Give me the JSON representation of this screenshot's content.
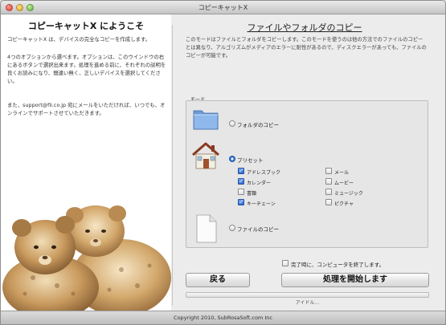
{
  "window": {
    "title": "コピーキャットX"
  },
  "welcome": {
    "title": "コピーキャットX にようこそ",
    "para1": "コピーキャットX は、デバイスの完全なコピーを作成します。",
    "para2": "4つのオプションから選べます。オプションは、このウインドウの右にあるボタンで選択出来ます。処理を進める前に、それぞれの説明を良くお読みになり、間違い無く、正しいデバイスを選択してください。",
    "para3": "また、support@fli.co.jp 宛にメールをいただければ、いつでも、オンラインでサポートさせていただきます。"
  },
  "mode": {
    "title": "ファイルやフォルダのコピー",
    "description": "このモードはファイルとフォルダをコピーします。このモードを使うのは他の方法でのファイルのコピーとは異なり、アルゴリズムがメディアのエラーに耐性があるので、ディスクエラーがあっても、ファイルのコピーが可能です。",
    "group_label": "モード",
    "options": [
      {
        "label": "フォルダのコピー",
        "icon": "folder-icon",
        "selected": false
      },
      {
        "label": "プリセット",
        "icon": "home-icon",
        "selected": true
      },
      {
        "label": "ファイルのコピー",
        "icon": "document-icon",
        "selected": false
      }
    ],
    "presets": [
      {
        "label": "アドレスブック",
        "checked": true
      },
      {
        "label": "メール",
        "checked": false
      },
      {
        "label": "カレンダー",
        "checked": true
      },
      {
        "label": "ムービー",
        "checked": false
      },
      {
        "label": "書類",
        "checked": false
      },
      {
        "label": "ミュージック",
        "checked": false
      },
      {
        "label": "キーチェーン",
        "checked": true
      },
      {
        "label": "ピクチャ",
        "checked": false
      }
    ]
  },
  "options": {
    "shutdown_label": "完了時に、コンピュータを終了します。",
    "shutdown_checked": false
  },
  "buttons": {
    "back": "戻る",
    "start": "処理を開始します"
  },
  "status": {
    "text": "アイドル…",
    "progress": 0
  },
  "footer": {
    "copyright": "Copyright 2010, SubRosaSoft.com Inc"
  },
  "colors": {
    "accent": "#2d66cc",
    "window_bg": "#ececec"
  }
}
